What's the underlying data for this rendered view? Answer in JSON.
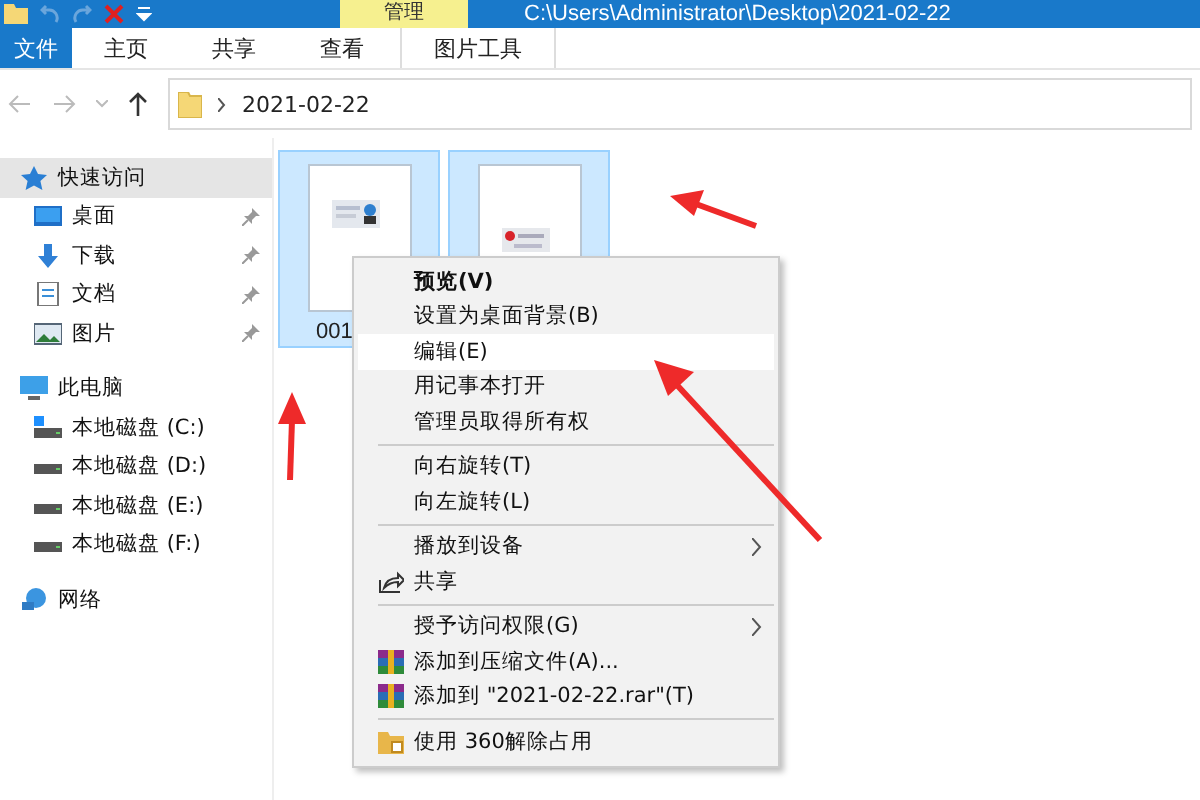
{
  "title_bar": {
    "context_tab": "管理",
    "path": "C:\\Users\\Administrator\\Desktop\\2021-02-22"
  },
  "ribbon_tabs": [
    {
      "label": "文件",
      "kind": "file"
    },
    {
      "label": "主页",
      "kind": "tab"
    },
    {
      "label": "共享",
      "kind": "tab"
    },
    {
      "label": "查看",
      "kind": "tab"
    },
    {
      "label": "图片工具",
      "kind": "context"
    }
  ],
  "address_bar": {
    "crumb": "2021-02-22"
  },
  "sidebar": {
    "items": [
      {
        "label": "快速访问",
        "kind": "star",
        "selected": true,
        "pinned": false,
        "children": [
          {
            "label": "桌面",
            "kind": "desktop",
            "selected": false,
            "pinned": true
          },
          {
            "label": "下载",
            "kind": "download",
            "selected": false,
            "pinned": true
          },
          {
            "label": "文档",
            "kind": "document",
            "selected": false,
            "pinned": true
          },
          {
            "label": "图片",
            "kind": "pictures",
            "selected": false,
            "pinned": true
          }
        ]
      },
      {
        "label": "此电脑",
        "kind": "pc",
        "selected": false,
        "pinned": false,
        "children": [
          {
            "label": "本地磁盘 (C:)",
            "kind": "system-drive",
            "selected": false,
            "pinned": false
          },
          {
            "label": "本地磁盘 (D:)",
            "kind": "drive",
            "selected": false,
            "pinned": false
          },
          {
            "label": "本地磁盘 (E:)",
            "kind": "drive",
            "selected": false,
            "pinned": false
          },
          {
            "label": "本地磁盘 (F:)",
            "kind": "drive",
            "selected": false,
            "pinned": false
          }
        ]
      },
      {
        "label": "网络",
        "kind": "network",
        "selected": false,
        "pinned": false
      }
    ]
  },
  "files": [
    {
      "name": "001",
      "selected": true,
      "kind": "picture"
    },
    {
      "selected": true,
      "kind": "picture"
    }
  ],
  "context_menu": [
    {
      "kind": "item",
      "label": "预览(V)",
      "bold": true,
      "selected": false
    },
    {
      "kind": "item",
      "label": "设置为桌面背景(B)",
      "bold": false,
      "selected": false
    },
    {
      "kind": "item",
      "label": "编辑(E)",
      "bold": false,
      "selected": true
    },
    {
      "kind": "item",
      "label": "用记事本打开",
      "bold": false,
      "selected": false
    },
    {
      "kind": "item",
      "label": "管理员取得所有权",
      "bold": false,
      "selected": false
    },
    {
      "kind": "separator"
    },
    {
      "kind": "item",
      "label": "向右旋转(T)",
      "bold": false,
      "selected": false
    },
    {
      "kind": "item",
      "label": "向左旋转(L)",
      "bold": false,
      "selected": false
    },
    {
      "kind": "separator"
    },
    {
      "kind": "item",
      "label": "播放到设备",
      "bold": false,
      "selected": false,
      "submenu": true
    },
    {
      "kind": "share",
      "label": "共享",
      "bold": false,
      "selected": false
    },
    {
      "kind": "separator"
    },
    {
      "kind": "item",
      "label": "授予访问权限(G)",
      "bold": false,
      "selected": false,
      "submenu": true
    },
    {
      "kind": "archive",
      "label": "添加到压缩文件(A)...",
      "bold": false,
      "selected": false
    },
    {
      "kind": "archive",
      "label": "添加到 \"2021-02-22.rar\"(T)",
      "bold": false,
      "selected": false
    },
    {
      "kind": "separator"
    },
    {
      "kind": "folder",
      "label": "使用 360解除占用",
      "bold": false,
      "selected": false
    }
  ]
}
